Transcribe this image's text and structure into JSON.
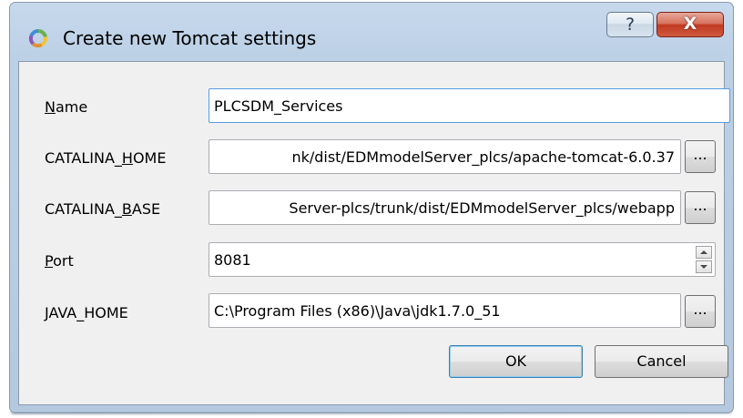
{
  "window": {
    "title": "Create new Tomcat settings",
    "help_glyph": "?",
    "close_glyph": "X",
    "icon": "tomcat-swirl-icon"
  },
  "form": {
    "fields": [
      {
        "label_pre": "",
        "mnemonic": "N",
        "label_post": "ame",
        "value": "PLCSDM_Services"
      },
      {
        "label_pre": "CATALINA_",
        "mnemonic": "H",
        "label_post": "OME",
        "value": "nk/dist/EDMmodelServer_plcs/apache-tomcat-6.0.37"
      },
      {
        "label_pre": "CATALINA_",
        "mnemonic": "B",
        "label_post": "ASE",
        "value": "Server-plcs/trunk/dist/EDMmodelServer_plcs/webapp"
      },
      {
        "label_pre": "",
        "mnemonic": "P",
        "label_post": "ort",
        "value": "8081"
      },
      {
        "label_pre": "",
        "mnemonic": "J",
        "label_post": "AVA_HOME",
        "value": "C:\\Program Files (x86)\\Java\\jdk1.7.0_51"
      }
    ],
    "browse_label": "..."
  },
  "buttons": {
    "ok": "OK",
    "cancel": "Cancel"
  },
  "colors": {
    "title_bar": "#bcd0e6",
    "close_button": "#c23a22",
    "dialog_bg": "#f0f0f0",
    "focus_border": "#569de5",
    "default_button_border": "#3c7fb1"
  }
}
